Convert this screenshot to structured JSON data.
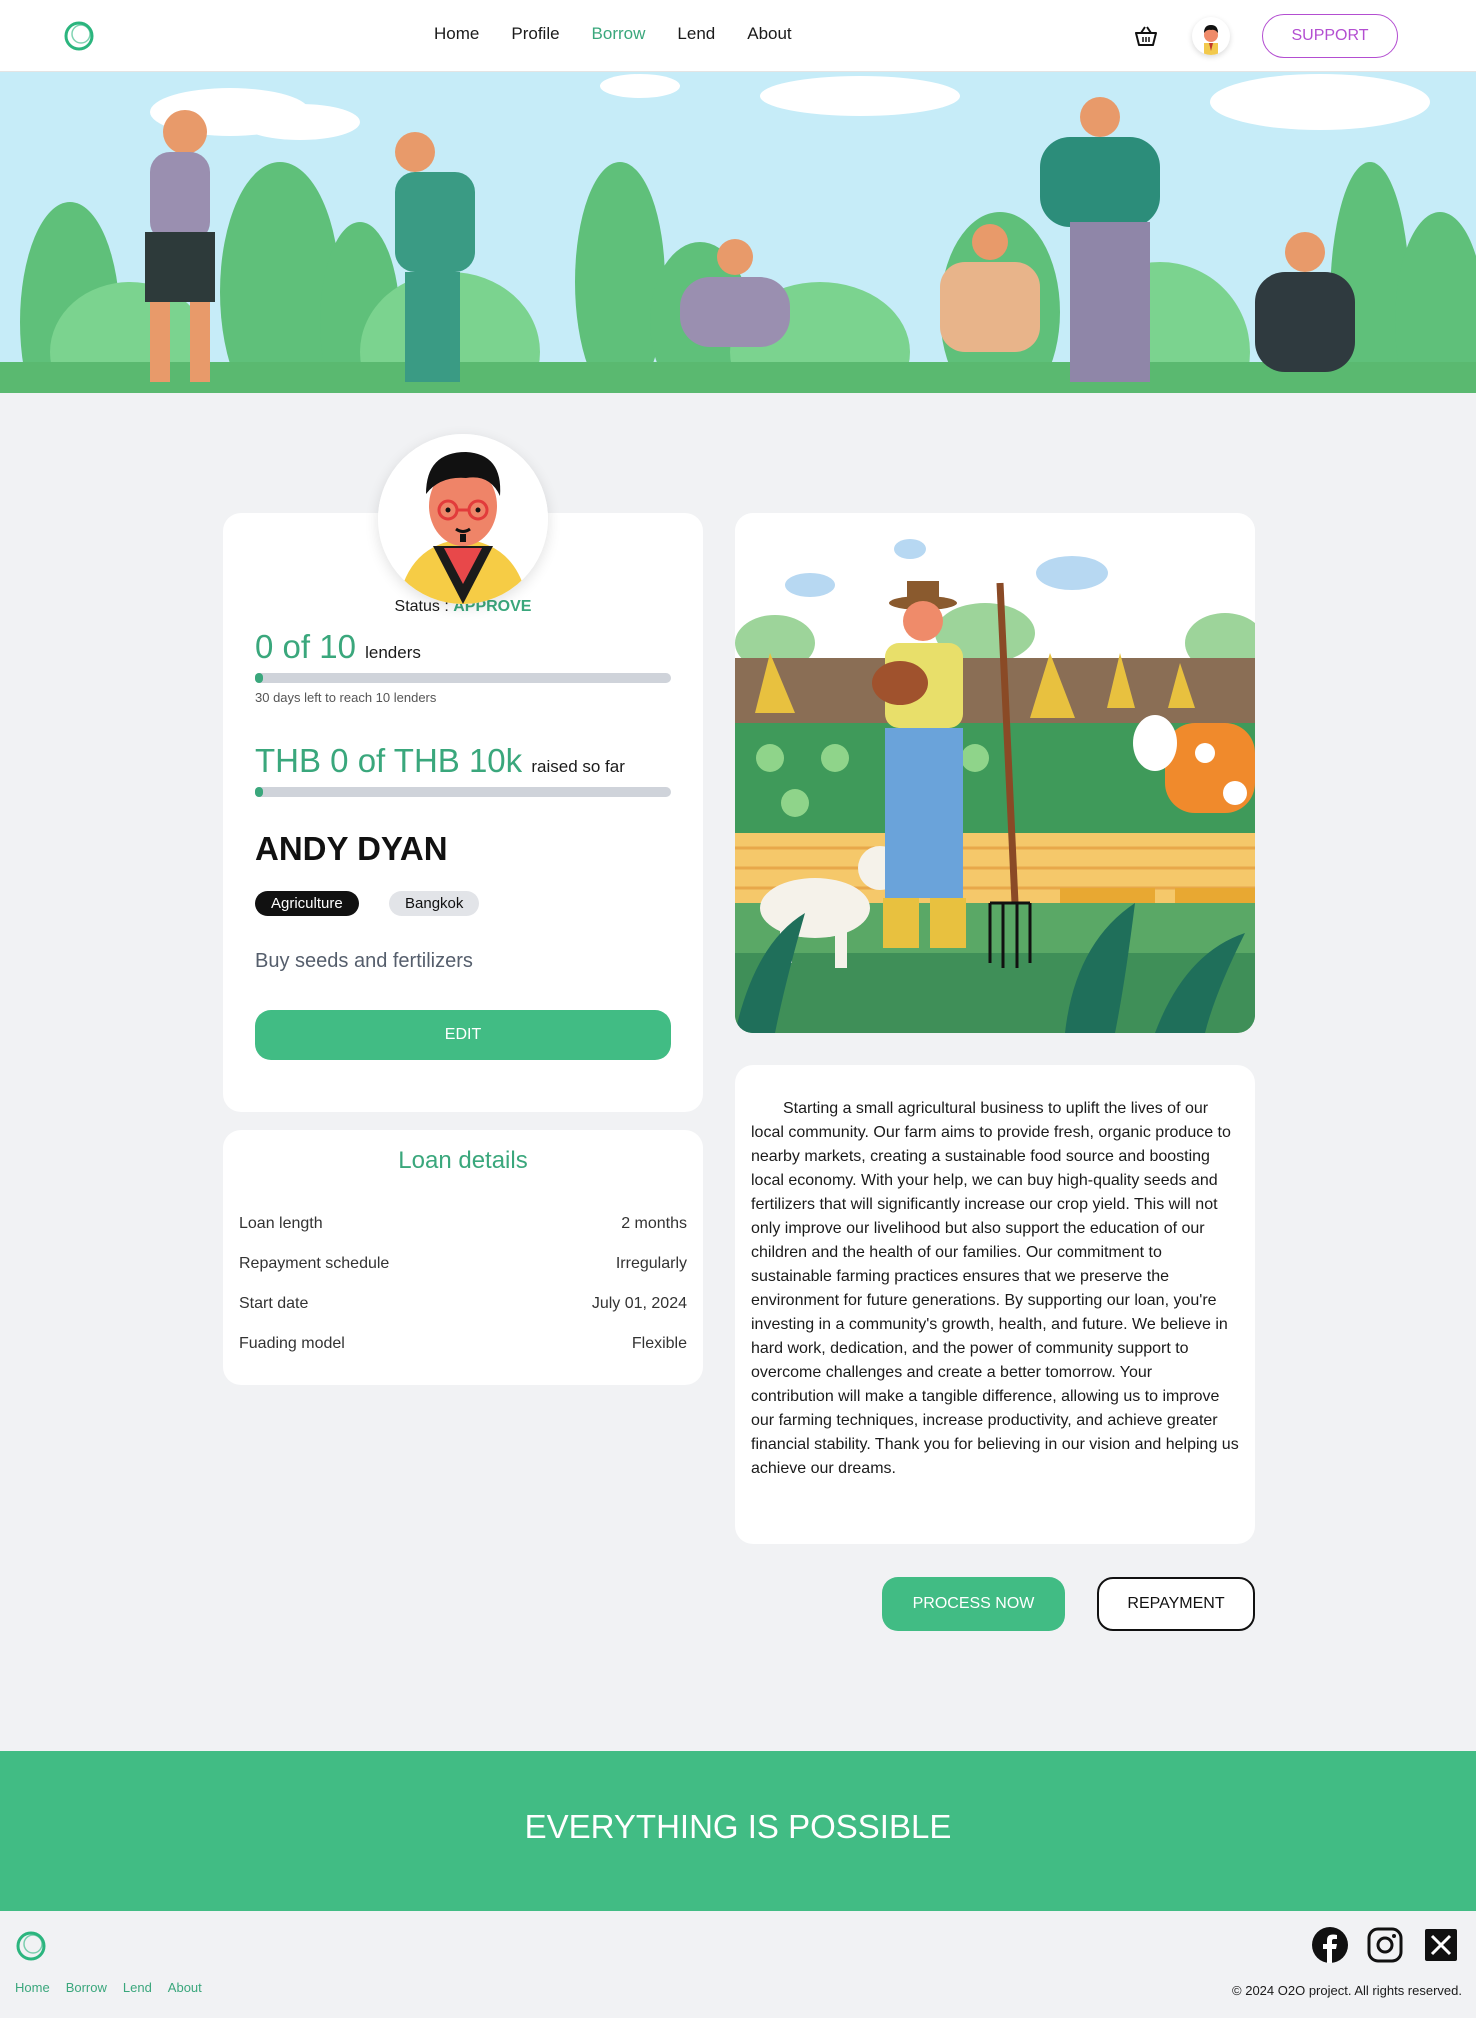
{
  "nav": {
    "links": [
      {
        "label": "Home"
      },
      {
        "label": "Profile"
      },
      {
        "label": "Borrow"
      },
      {
        "label": "Lend"
      },
      {
        "label": "About"
      }
    ],
    "active_link": "Borrow",
    "support_label": "SUPPORT"
  },
  "profile": {
    "status_label": "Status :",
    "status_value": "APPROVE",
    "lenders_count": "0 of 10",
    "lenders_suffix": "lenders",
    "lenders_progress": 0,
    "days_left": "30 days left to reach 10 lenders",
    "raised_amount": "THB 0 of THB 10k",
    "raised_suffix": "raised so far",
    "raised_progress": 0,
    "name": "ANDY DYAN",
    "tags": [
      "Agriculture",
      "Bangkok"
    ],
    "purpose": "Buy seeds and fertilizers",
    "edit_label": "EDIT"
  },
  "loan": {
    "title": "Loan details",
    "rows": [
      {
        "label": "Loan length",
        "value": "2 months"
      },
      {
        "label": "Repayment schedule",
        "value": "Irregularly"
      },
      {
        "label": "Start date",
        "value": "July 01, 2024"
      },
      {
        "label": "Fuading model",
        "value": "Flexible"
      }
    ]
  },
  "story": {
    "text": "Starting a small agricultural business to uplift the lives of our local community. Our farm aims to provide fresh, organic produce to nearby markets, creating a sustainable food source and boosting local economy. With your help, we can buy high-quality seeds and fertilizers that will significantly increase our crop yield. This will not only improve our livelihood but also support the education of our children and the health of our families. Our commitment to sustainable farming practices ensures that we preserve the environment for future generations. By supporting our loan, you're investing in a community's growth, health, and future. We believe in hard work, dedication, and the power of community support to overcome challenges and create a better tomorrow. Your contribution will make a tangible difference, allowing us to improve our farming techniques, increase productivity, and achieve greater financial stability. Thank you for believing in our vision and helping us achieve our dreams."
  },
  "actions": {
    "process_label": "PROCESS NOW",
    "repayment_label": "REPAYMENT"
  },
  "banner": {
    "text": "EVERYTHING IS POSSIBLE"
  },
  "footer": {
    "links": [
      {
        "label": "Home"
      },
      {
        "label": "Borrow"
      },
      {
        "label": "Lend"
      },
      {
        "label": "About"
      }
    ],
    "copyright": "© 2024 O2O project. All rights reserved.",
    "social_icons": [
      "facebook-icon",
      "instagram-icon",
      "x-icon"
    ]
  },
  "colors": {
    "accent": "#41bc84",
    "accent_text": "#3aa77c",
    "support": "#b34ed1",
    "background": "#f1f2f4"
  }
}
